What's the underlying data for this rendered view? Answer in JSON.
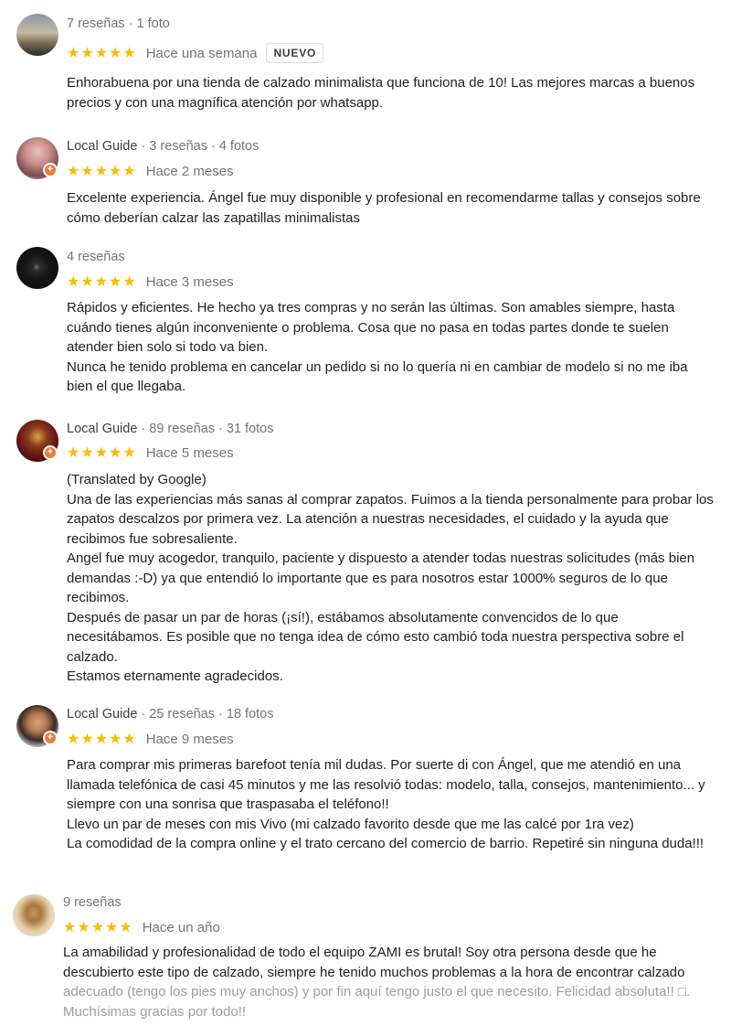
{
  "colors": {
    "star": "#fbbc04",
    "badge": "#f07a3e",
    "meta": "#70757a"
  },
  "reviews": [
    {
      "meta_prefix": "",
      "meta": "7 reseñas · 1 foto",
      "stars": "★★★★★",
      "time": "Hace una semana",
      "tag": "NUEVO",
      "lines": [
        "Enhorabuena por una tienda de calzado minimalista que funciona de 10! Las mejores marcas a buenos precios y con una magnífica atención por whatsapp."
      ]
    },
    {
      "meta_prefix": "Local Guide",
      "meta": " · 3 reseñas · 4 fotos",
      "stars": "★★★★★",
      "time": "Hace 2 meses",
      "lines": [
        "Excelente experiencia. Ángel fue muy disponible y profesional en recomendarme tallas y consejos sobre cómo deberían calzar las zapatillas minimalistas"
      ]
    },
    {
      "meta_prefix": "",
      "meta": "4 reseñas",
      "stars": "★★★★★",
      "time": "Hace 3 meses",
      "lines": [
        "Rápidos y eficientes. He hecho ya tres compras y no serán las últimas. Son amables siempre, hasta cuándo tienes algún inconveniente o problema. Cosa que no pasa en todas partes donde te suelen atender bien solo si todo va bien.",
        "Nunca he tenido problema en cancelar un pedido si no lo quería ni en cambiar de modelo si no me iba bien el que llegaba."
      ]
    },
    {
      "meta_prefix": "Local Guide",
      "meta": " · 89 reseñas · 31 fotos",
      "stars": "★★★★★",
      "time": "Hace 5 meses",
      "lines": [
        "(Translated by Google)",
        "Una de las experiencias más sanas al comprar zapatos. Fuimos a la tienda personalmente para probar los zapatos descalzos por primera vez. La atención a nuestras necesidades, el cuidado y la ayuda que recibimos fue sobresaliente.",
        "Angel fue muy acogedor, tranquilo, paciente y dispuesto a atender todas nuestras solicitudes (más bien demandas :-D) ya que entendió lo importante que es para nosotros estar 1000% seguros de lo que recibimos.",
        "Después de pasar un par de horas (¡sí!), estábamos absolutamente convencidos de lo que necesitábamos. Es posible que no tenga idea de cómo esto cambió toda nuestra perspectiva sobre el calzado.",
        "Estamos eternamente agradecidos."
      ]
    },
    {
      "meta_prefix": "Local Guide",
      "meta": " · 25 reseñas · 18 fotos",
      "stars": "★★★★★",
      "time": "Hace 9 meses",
      "lines": [
        "Para comprar mis primeras barefoot tenía mil dudas. Por suerte di con Ángel, que me atendió en una llamada telefónica de casi 45 minutos y me las resolvió todas: modelo, talla, consejos, mantenimiento... y siempre con una sonrisa que traspasaba el teléfono!!",
        "Llevo un par de meses con mis Vivo (mi calzado favorito desde  que me las calcé por 1ra vez)",
        "La comodidad de la compra online y el trato cercano del comercio de barrio. Repetiré sin ninguna duda!!!"
      ]
    },
    {
      "meta_prefix": "",
      "meta": "9 reseñas",
      "stars": "★★★★★",
      "time": "Hace un año",
      "lines": [
        "La amabilidad y profesionalidad de todo el equipo ZAMI es brutal! Soy otra persona desde que he descubierto este tipo de calzado, siempre he tenido muchos problemas a la hora de encontrar calzado",
        "adecuado (tengo los pies muy anchos) y por fin aquí tengo justo el que necesito. Felicidad absoluta!! □.",
        "Muchísimas gracias por todo!!"
      ]
    }
  ]
}
